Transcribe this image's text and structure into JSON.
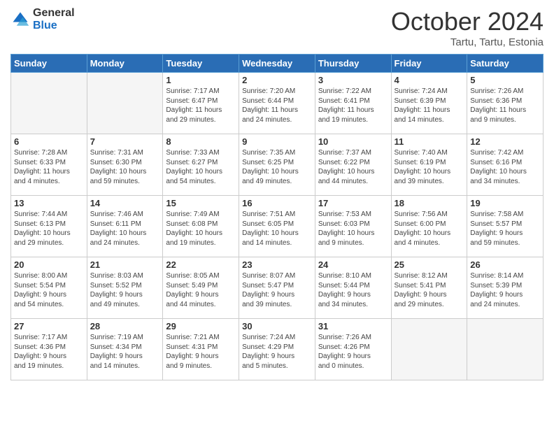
{
  "logo": {
    "general": "General",
    "blue": "Blue"
  },
  "header": {
    "month": "October 2024",
    "location": "Tartu, Tartu, Estonia"
  },
  "weekdays": [
    "Sunday",
    "Monday",
    "Tuesday",
    "Wednesday",
    "Thursday",
    "Friday",
    "Saturday"
  ],
  "weeks": [
    [
      {
        "day": "",
        "info": ""
      },
      {
        "day": "",
        "info": ""
      },
      {
        "day": "1",
        "info": "Sunrise: 7:17 AM\nSunset: 6:47 PM\nDaylight: 11 hours\nand 29 minutes."
      },
      {
        "day": "2",
        "info": "Sunrise: 7:20 AM\nSunset: 6:44 PM\nDaylight: 11 hours\nand 24 minutes."
      },
      {
        "day": "3",
        "info": "Sunrise: 7:22 AM\nSunset: 6:41 PM\nDaylight: 11 hours\nand 19 minutes."
      },
      {
        "day": "4",
        "info": "Sunrise: 7:24 AM\nSunset: 6:39 PM\nDaylight: 11 hours\nand 14 minutes."
      },
      {
        "day": "5",
        "info": "Sunrise: 7:26 AM\nSunset: 6:36 PM\nDaylight: 11 hours\nand 9 minutes."
      }
    ],
    [
      {
        "day": "6",
        "info": "Sunrise: 7:28 AM\nSunset: 6:33 PM\nDaylight: 11 hours\nand 4 minutes."
      },
      {
        "day": "7",
        "info": "Sunrise: 7:31 AM\nSunset: 6:30 PM\nDaylight: 10 hours\nand 59 minutes."
      },
      {
        "day": "8",
        "info": "Sunrise: 7:33 AM\nSunset: 6:27 PM\nDaylight: 10 hours\nand 54 minutes."
      },
      {
        "day": "9",
        "info": "Sunrise: 7:35 AM\nSunset: 6:25 PM\nDaylight: 10 hours\nand 49 minutes."
      },
      {
        "day": "10",
        "info": "Sunrise: 7:37 AM\nSunset: 6:22 PM\nDaylight: 10 hours\nand 44 minutes."
      },
      {
        "day": "11",
        "info": "Sunrise: 7:40 AM\nSunset: 6:19 PM\nDaylight: 10 hours\nand 39 minutes."
      },
      {
        "day": "12",
        "info": "Sunrise: 7:42 AM\nSunset: 6:16 PM\nDaylight: 10 hours\nand 34 minutes."
      }
    ],
    [
      {
        "day": "13",
        "info": "Sunrise: 7:44 AM\nSunset: 6:13 PM\nDaylight: 10 hours\nand 29 minutes."
      },
      {
        "day": "14",
        "info": "Sunrise: 7:46 AM\nSunset: 6:11 PM\nDaylight: 10 hours\nand 24 minutes."
      },
      {
        "day": "15",
        "info": "Sunrise: 7:49 AM\nSunset: 6:08 PM\nDaylight: 10 hours\nand 19 minutes."
      },
      {
        "day": "16",
        "info": "Sunrise: 7:51 AM\nSunset: 6:05 PM\nDaylight: 10 hours\nand 14 minutes."
      },
      {
        "day": "17",
        "info": "Sunrise: 7:53 AM\nSunset: 6:03 PM\nDaylight: 10 hours\nand 9 minutes."
      },
      {
        "day": "18",
        "info": "Sunrise: 7:56 AM\nSunset: 6:00 PM\nDaylight: 10 hours\nand 4 minutes."
      },
      {
        "day": "19",
        "info": "Sunrise: 7:58 AM\nSunset: 5:57 PM\nDaylight: 9 hours\nand 59 minutes."
      }
    ],
    [
      {
        "day": "20",
        "info": "Sunrise: 8:00 AM\nSunset: 5:54 PM\nDaylight: 9 hours\nand 54 minutes."
      },
      {
        "day": "21",
        "info": "Sunrise: 8:03 AM\nSunset: 5:52 PM\nDaylight: 9 hours\nand 49 minutes."
      },
      {
        "day": "22",
        "info": "Sunrise: 8:05 AM\nSunset: 5:49 PM\nDaylight: 9 hours\nand 44 minutes."
      },
      {
        "day": "23",
        "info": "Sunrise: 8:07 AM\nSunset: 5:47 PM\nDaylight: 9 hours\nand 39 minutes."
      },
      {
        "day": "24",
        "info": "Sunrise: 8:10 AM\nSunset: 5:44 PM\nDaylight: 9 hours\nand 34 minutes."
      },
      {
        "day": "25",
        "info": "Sunrise: 8:12 AM\nSunset: 5:41 PM\nDaylight: 9 hours\nand 29 minutes."
      },
      {
        "day": "26",
        "info": "Sunrise: 8:14 AM\nSunset: 5:39 PM\nDaylight: 9 hours\nand 24 minutes."
      }
    ],
    [
      {
        "day": "27",
        "info": "Sunrise: 7:17 AM\nSunset: 4:36 PM\nDaylight: 9 hours\nand 19 minutes."
      },
      {
        "day": "28",
        "info": "Sunrise: 7:19 AM\nSunset: 4:34 PM\nDaylight: 9 hours\nand 14 minutes."
      },
      {
        "day": "29",
        "info": "Sunrise: 7:21 AM\nSunset: 4:31 PM\nDaylight: 9 hours\nand 9 minutes."
      },
      {
        "day": "30",
        "info": "Sunrise: 7:24 AM\nSunset: 4:29 PM\nDaylight: 9 hours\nand 5 minutes."
      },
      {
        "day": "31",
        "info": "Sunrise: 7:26 AM\nSunset: 4:26 PM\nDaylight: 9 hours\nand 0 minutes."
      },
      {
        "day": "",
        "info": ""
      },
      {
        "day": "",
        "info": ""
      }
    ]
  ]
}
